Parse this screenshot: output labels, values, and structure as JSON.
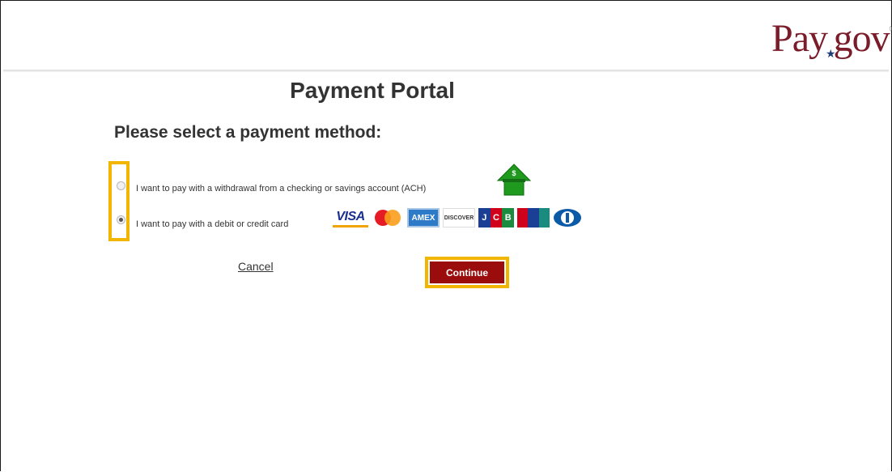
{
  "brand": {
    "logo_text_pay": "Pay",
    "logo_text_gov": "gov",
    "logo_color": "#7a1c2a"
  },
  "page": {
    "title": "Payment Portal",
    "subtitle": "Please select a payment method:"
  },
  "payment_options": [
    {
      "label": "I want to pay with a withdrawal from a checking or savings account (ACH)",
      "selected": false,
      "icon": "bank-house-icon"
    },
    {
      "label": "I want to pay with a debit or credit card",
      "selected": true,
      "icons": [
        "visa-icon",
        "mastercard-icon",
        "amex-icon",
        "discover-icon",
        "jcb-icon",
        "unionpay-icon",
        "diners-club-icon"
      ]
    }
  ],
  "cards": {
    "visa": "VISA",
    "amex": "AMEX",
    "discover": "DISCOVER",
    "jcb": "JCB"
  },
  "actions": {
    "cancel_label": "Cancel",
    "continue_label": "Continue"
  },
  "colors": {
    "highlight": "#f2b600",
    "continue_bg": "#9b0d0d",
    "house_green": "#1f9a1f"
  }
}
